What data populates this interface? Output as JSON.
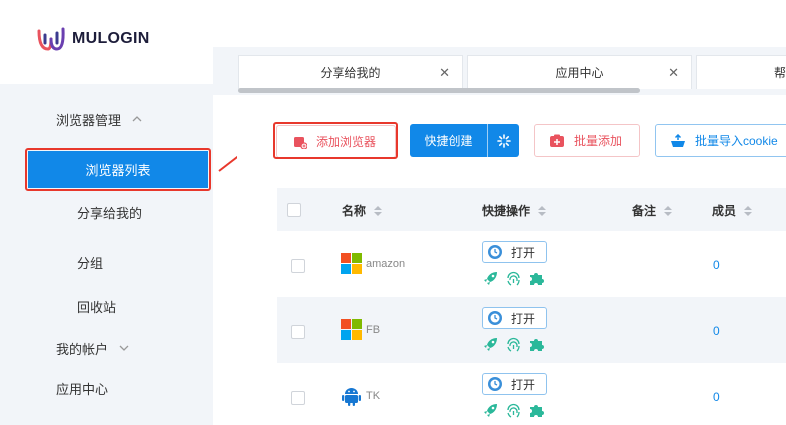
{
  "brand": {
    "name": "MULOGIN",
    "accent": "#1188e8",
    "danger": "#e9535e"
  },
  "sidebar": {
    "items": [
      {
        "label": "浏览器管理",
        "expanded": true
      },
      {
        "label": "浏览器列表",
        "active": true
      },
      {
        "label": "分享给我的"
      },
      {
        "label": "分组"
      },
      {
        "label": "回收站"
      },
      {
        "label": "我的帐户",
        "expanded": false
      },
      {
        "label": "应用中心"
      }
    ]
  },
  "tabs": [
    {
      "label": "分享给我的"
    },
    {
      "label": "应用中心"
    },
    {
      "label": "帮"
    }
  ],
  "toolbar": {
    "add_browser": "添加浏览器",
    "quick_create": "快捷创建",
    "batch_add": "批量添加",
    "batch_import": "批量导入cookie"
  },
  "table": {
    "columns": {
      "name": "名称",
      "quick_actions": "快捷操作",
      "note": "备注",
      "members": "成员"
    },
    "rows": [
      {
        "os": "windows-icon",
        "name": "amazon",
        "open": "打开",
        "members": "0"
      },
      {
        "os": "windows-icon",
        "name": "FB",
        "open": "打开",
        "members": "0"
      },
      {
        "os": "android-icon",
        "name": "TK",
        "open": "打开",
        "members": "0"
      }
    ]
  }
}
